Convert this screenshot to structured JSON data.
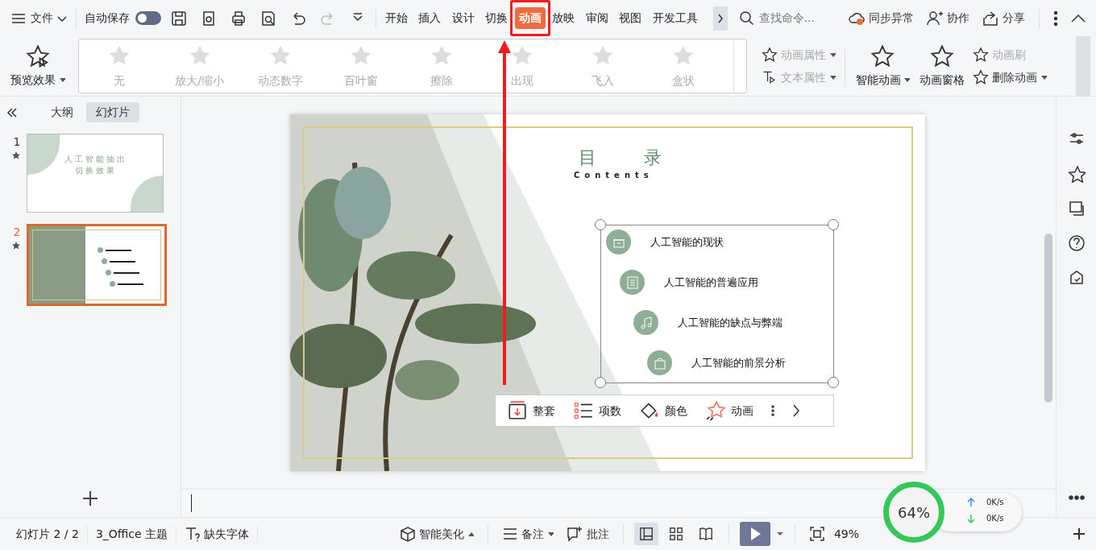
{
  "title_bar": {
    "menu_label": "文件",
    "autosave_label": "自动保存",
    "autosave_on": false,
    "tabs": [
      {
        "label": "开始",
        "selected": false
      },
      {
        "label": "插入",
        "selected": false
      },
      {
        "label": "设计",
        "selected": false
      },
      {
        "label": "切换",
        "selected": false
      },
      {
        "label": "动画",
        "selected": true
      },
      {
        "label": "放映",
        "selected": false
      },
      {
        "label": "审阅",
        "selected": false
      },
      {
        "label": "视图",
        "selected": false
      },
      {
        "label": "开发工具",
        "selected": false
      }
    ],
    "search": {
      "placeholder": "查找命令..."
    },
    "actions": [
      "同步异常",
      "协作",
      "分享"
    ]
  },
  "ribbon": {
    "preview": "预览效果",
    "effects": [
      "无",
      "放大/缩小",
      "动态数字",
      "百叶窗",
      "擦除",
      "出现",
      "飞入",
      "盒状"
    ],
    "properties": [
      {
        "label": "动画属性",
        "disabled": true
      },
      {
        "label": "文本属性",
        "disabled": true
      }
    ],
    "tools": [
      {
        "label": "智能动画",
        "disabled": false
      },
      {
        "label": "动画窗格",
        "disabled": false
      }
    ],
    "small_tools": [
      {
        "label": "动画刷",
        "disabled": true
      },
      {
        "label": "删除动画",
        "disabled": false
      }
    ]
  },
  "left_panel": {
    "view_tabs": [
      {
        "label": "大纲",
        "selected": false
      },
      {
        "label": "幻灯片",
        "selected": true
      }
    ],
    "slides": [
      {
        "number": "1",
        "selected": false,
        "kind": "title"
      },
      {
        "number": "2",
        "selected": true,
        "kind": "contents"
      }
    ],
    "thumb_title_lines": [
      "人 工 智 能 抽 出",
      "切 换 效 果"
    ]
  },
  "slide": {
    "title": "目 录",
    "subtitle": "Contents",
    "items": [
      "人工智能的现状",
      "人工智能的普遍应用",
      "人工智能的缺点与弊端",
      "人工智能的前景分析"
    ],
    "toolbar": [
      "整套",
      "项数",
      "颜色",
      "动画"
    ]
  },
  "status_bar": {
    "left": [
      "幻灯片 2 / 2",
      "3_Office 主题",
      "缺失字体"
    ],
    "beautify": "智能美化",
    "notes": "备注",
    "comment": "批注",
    "views": [
      {
        "selected": true
      },
      {
        "selected": false
      },
      {
        "selected": false
      }
    ],
    "zoom": "49%"
  },
  "speed_widget": {
    "percent": "64%",
    "up": "0K/s",
    "down": "0K/s"
  }
}
